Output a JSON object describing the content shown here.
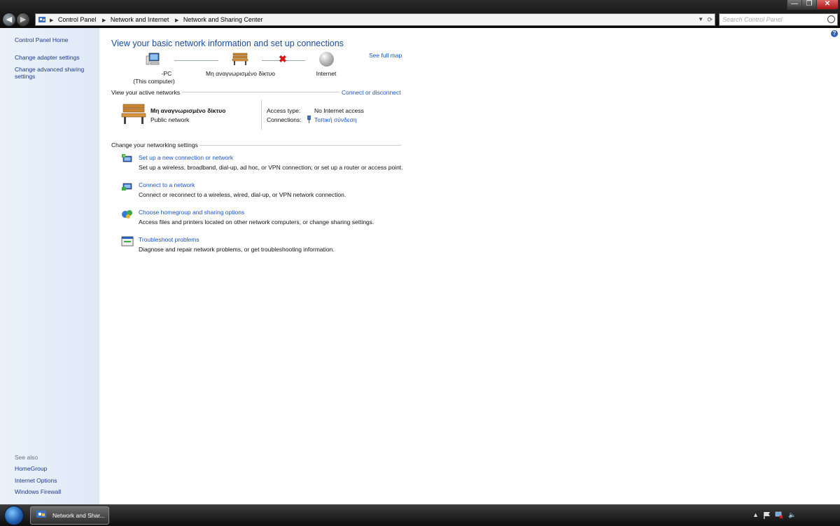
{
  "address_bar": {
    "crumbs": [
      "Control Panel",
      "Network and Internet",
      "Network and Sharing Center"
    ],
    "search_placeholder": "Search Control Panel"
  },
  "left_pane": {
    "links": [
      "Control Panel Home",
      "Change adapter settings",
      "Change advanced sharing settings"
    ],
    "see_also_label": "See also",
    "see_also": [
      "HomeGroup",
      "Internet Options",
      "Windows Firewall"
    ]
  },
  "main": {
    "title": "View your basic network information and set up connections",
    "see_full_map": "See full map",
    "map": {
      "computer_name": "-PC",
      "computer_sub": "(This computer)",
      "network_name": "Μη αναγνωρισμένο δίκτυο",
      "internet_label": "Internet"
    },
    "active_networks_label": "View your active networks",
    "connect_disconnect": "Connect or disconnect",
    "network": {
      "name": "Μη αναγνωρισμένο δίκτυο",
      "type": "Public network",
      "access_type_label": "Access type:",
      "access_type_value": "No Internet access",
      "connections_label": "Connections:",
      "connection_link": "Τοπική σύνδεση"
    },
    "settings_label": "Change your networking settings",
    "tasks": [
      {
        "title": "Set up a new connection or network",
        "desc": "Set up a wireless, broadband, dial-up, ad hoc, or VPN connection; or set up a router or access point."
      },
      {
        "title": "Connect to a network",
        "desc": "Connect or reconnect to a wireless, wired, dial-up, or VPN network connection."
      },
      {
        "title": "Choose homegroup and sharing options",
        "desc": "Access files and printers located on other network computers, or change sharing settings."
      },
      {
        "title": "Troubleshoot problems",
        "desc": "Diagnose and repair network problems, or get troubleshooting information."
      }
    ]
  },
  "taskbar": {
    "window_button": "Network and Shar..."
  },
  "colors": {
    "link": "#1a55c4",
    "title": "#1a4a9a",
    "error_x": "#d21919"
  }
}
